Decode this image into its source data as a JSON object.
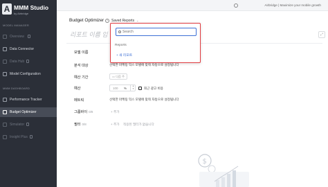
{
  "brand": {
    "logo_letter": "A",
    "title": "MMM Studio",
    "subtitle": "by Airbridge"
  },
  "sidebar": {
    "section_model": "MODEL MANAGER",
    "section_dashboard": "MMM DASHBOARD",
    "items": [
      {
        "label": "Overview",
        "disabled": true
      },
      {
        "label": "Data Connector",
        "disabled": false
      },
      {
        "label": "Data Hub",
        "disabled": true
      },
      {
        "label": "Model Configuration",
        "disabled": false
      },
      {
        "label": "Performance Tracker",
        "disabled": false
      },
      {
        "label": "Budget Optimizer",
        "disabled": false,
        "active": true
      },
      {
        "label": "Simulator",
        "disabled": true
      },
      {
        "label": "Insight Plus",
        "disabled": true
      }
    ]
  },
  "topbar": {
    "text": "Airbridge | Maximize your mobile growth"
  },
  "page": {
    "title": "Budget Optimizer",
    "saved_reports": "Saved Reports",
    "report_name_placeholder": "리포트 이름 입"
  },
  "form": {
    "model_label": "모델 이름",
    "target_label": "분석 대상",
    "target_hint": "선택한 마케팅 믹스 모델에 맞춰 자동으로 설정됩니다",
    "period_label": "예산 기간",
    "period_button": "다음 주",
    "budget_label": "예산",
    "budget_value": "100",
    "budget_unit": "%",
    "budget_checkbox_label": "최근 광고 비용",
    "metric_label": "메트릭",
    "metric_hint": "선택한 마케팅 믹스 모델에 맞춰 자동으로 설정됩니다",
    "group_label": "그룹바이",
    "group_count": "0/8",
    "group_add": "+ 추가",
    "filter_label": "필터",
    "filter_count": "0/8",
    "filter_add": "+ 추가",
    "filter_hint": "적용된 필터가 없습니다"
  },
  "dropdown": {
    "search_placeholder": "Search",
    "section_label": "Reports",
    "new_report": "+ 새 리포트"
  },
  "colors": {
    "sidebar_bg": "#2b2f38",
    "active_item_bg": "#474c57",
    "accent_blue": "#3d6fd6",
    "highlight_red": "#e0393e"
  }
}
